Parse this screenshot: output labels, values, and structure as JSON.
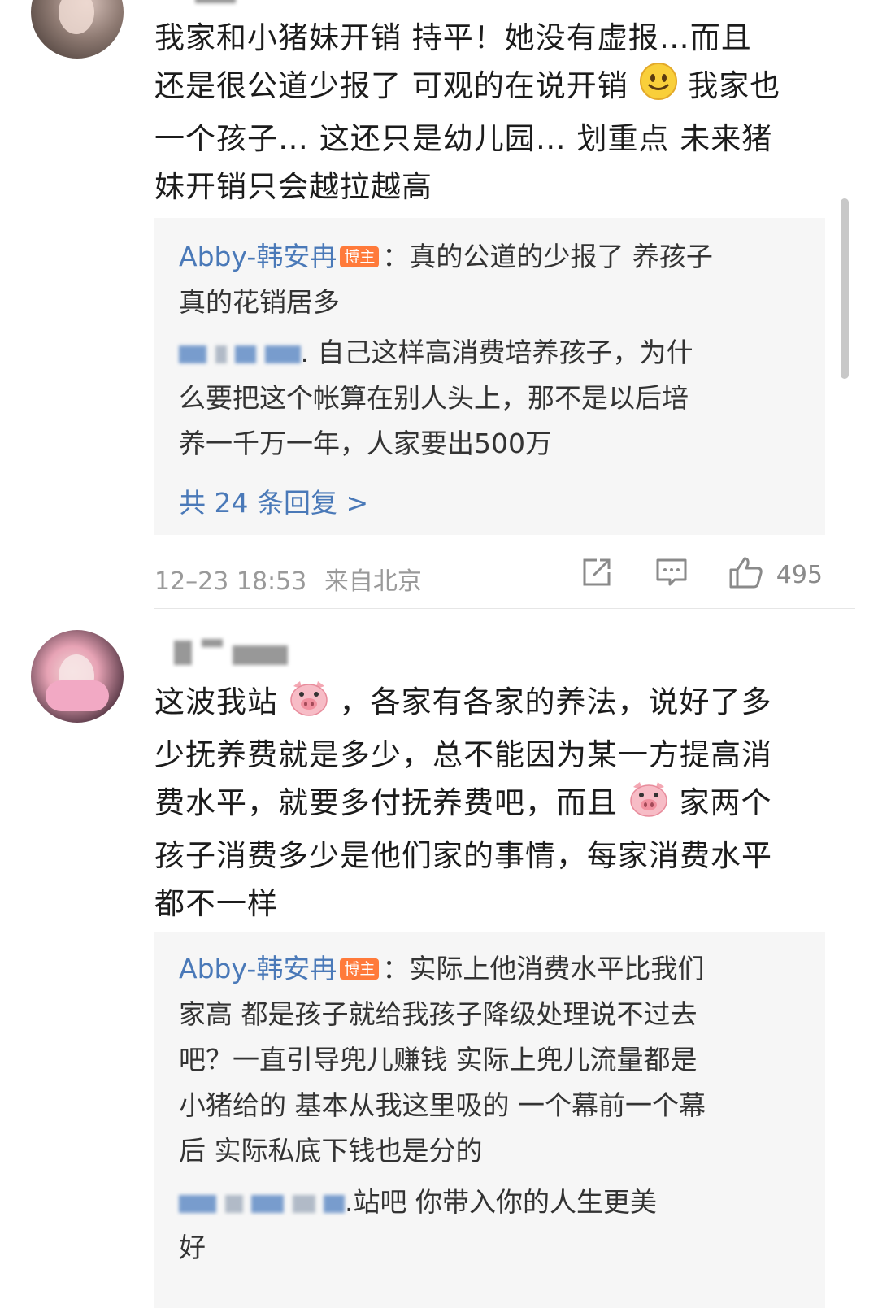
{
  "comments": [
    {
      "text_line1": "我家和小猪妹开销 持平！她没有虚报…而且",
      "text_line2a": "还是很公道少报了 可观的在说开销",
      "text_line2b": "我家也",
      "text_line3": "一个孩子… 这还只是幼儿园… 划重点 未来猪",
      "text_line4": "妹开销只会越拉越高",
      "reply_author": "Abby-韩安冉",
      "reply_badge": "博主",
      "reply_text_a": "：真的公道的少报了 养孩子",
      "reply_text_b": "真的花销居多",
      "reply2_text_a": ". 自己这样高消费培养孩子，为什",
      "reply2_text_b": "么要把这个帐算在别人头上，那不是以后培",
      "reply2_text_c": "养一千万一年，人家要出500万",
      "more_replies": "共 24 条回复 >",
      "time": "12–23 18:53",
      "location": "来自北京",
      "likes": "495"
    },
    {
      "text_line1a": "这波我站",
      "text_line1b": "，各家有各家的养法，说好了多",
      "text_line2": "少抚养费就是多少，总不能因为某一方提高消",
      "text_line3a": "费水平，就要多付抚养费吧，而且",
      "text_line3b": "家两个",
      "text_line4": "孩子消费多少是他们家的事情，每家消费水平",
      "text_line5": "都不一样",
      "reply_author": "Abby-韩安冉",
      "reply_badge": "博主",
      "reply_text_a": "：实际上他消费水平比我们",
      "reply_text_b": "家高 都是孩子就给我孩子降级处理说不过去",
      "reply_text_c": "吧？一直引导兜儿赚钱 实际上兜儿流量都是",
      "reply_text_d": "小猪给的 基本从我这里吸的  一个幕前一个幕",
      "reply_text_e": "后 实际私底下钱也是分的",
      "reply2_text_a": ".站吧 你带入你的人生更美",
      "reply2_text_b": "好"
    }
  ],
  "icons": {
    "share": "share-icon",
    "comment": "comment-icon",
    "like": "thumbs-up-icon",
    "emoji_smile": "smile-emoji",
    "emoji_pig": "pig-emoji"
  },
  "colors": {
    "link_blue": "#4a79b8",
    "badge_orange": "#ff7a3a",
    "reply_bg": "#f6f6f6",
    "meta_grey": "#9a9a9a"
  }
}
